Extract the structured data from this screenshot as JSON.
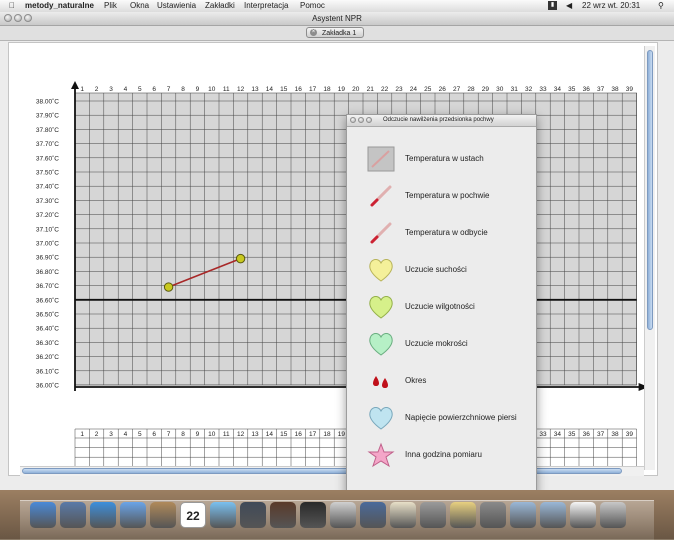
{
  "menubar": {
    "apple_icon": "apple-icon",
    "app_name": "metody_naturalne",
    "menus": [
      "Plik",
      "Okna",
      "Ustawienia",
      "Zakładki",
      "Interpretacja",
      "Pomoc"
    ],
    "clock": "22 wrz wt.  20:31",
    "status_icons": [
      "keyboard-layout-icon",
      "volume-icon",
      "bluetooth-icon",
      "spotlight-icon"
    ]
  },
  "window": {
    "title": "Asystent NPR"
  },
  "tabs": [
    {
      "label": "Zakładka 1"
    }
  ],
  "chart": {
    "day_labels": [
      "1",
      "2",
      "3",
      "4",
      "5",
      "6",
      "7",
      "8",
      "9",
      "10",
      "11",
      "12",
      "13",
      "14",
      "15",
      "16",
      "17",
      "18",
      "19",
      "20",
      "21",
      "22",
      "23",
      "24",
      "25",
      "26",
      "27",
      "28",
      "29",
      "30",
      "31",
      "32",
      "33",
      "34",
      "35",
      "36",
      "37",
      "38",
      "39"
    ],
    "temp_labels": [
      "38.00˚C",
      "37.90˚C",
      "37.80˚C",
      "37.70˚C",
      "37.60˚C",
      "37.50˚C",
      "37.40˚C",
      "37.30˚C",
      "37.20˚C",
      "37.10˚C",
      "37.00˚C",
      "36.90˚C",
      "36.80˚C",
      "36.70˚C",
      "36.60˚C",
      "36.50˚C",
      "36.40˚C",
      "36.30˚C",
      "36.20˚C",
      "36.10˚C",
      "36.00˚C"
    ]
  },
  "chart_data": {
    "type": "line",
    "x_axis_days": [
      1,
      39
    ],
    "y_axis_temp": [
      36.0,
      38.0
    ],
    "baseline_temp": 36.6,
    "series": [
      {
        "points": [
          {
            "day": 7,
            "temp": 36.69
          },
          {
            "day": 12,
            "temp": 36.89
          }
        ]
      }
    ],
    "grid": true
  },
  "palette": {
    "title": "Odczucie nawilżenia przedsionka pochwy",
    "items": [
      {
        "label": "Temperatura w ustach",
        "icon": "mouth-thermometer-icon"
      },
      {
        "label": "Temperatura w pochwie",
        "icon": "thermometer-icon"
      },
      {
        "label": "Temperatura w odbycie",
        "icon": "thermometer-icon"
      },
      {
        "label": "Uczucie suchości",
        "icon": "yellow-heart-icon"
      },
      {
        "label": "Uczucie wilgotności",
        "icon": "green-yellow-heart-icon"
      },
      {
        "label": "Uczucie mokrości",
        "icon": "green-heart-icon"
      },
      {
        "label": "Okres",
        "icon": "blood-drops-icon"
      },
      {
        "label": "Napięcie powierzchniowe piersi",
        "icon": "blue-heart-icon"
      },
      {
        "label": "Inna godzina pomiaru",
        "icon": "pink-star-icon"
      }
    ]
  },
  "dock": {
    "apps": [
      "finder-icon",
      "preview-icon",
      "safari-icon",
      "ichat-icon",
      "address-book-icon",
      "ical-icon",
      "itunes-icon",
      "photo-booth-icon",
      "timemachine-icon",
      "xcode-icon",
      "system-preferences-icon",
      "iphoto-icon",
      "script-editor-icon",
      "grapher-icon",
      "pencil-icon",
      "utilities-icon",
      "applications-folder-icon",
      "documents-folder-icon",
      "document-icon",
      "trash-icon"
    ],
    "calendar_day": "22"
  }
}
